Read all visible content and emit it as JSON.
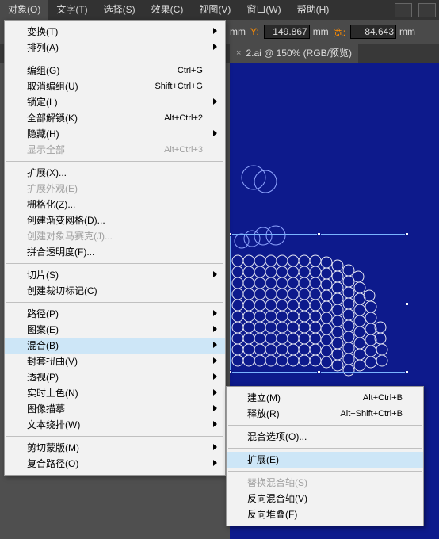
{
  "menubar": {
    "items": [
      "对象(O)",
      "文字(T)",
      "选择(S)",
      "效果(C)",
      "视图(V)",
      "窗口(W)",
      "帮助(H)"
    ]
  },
  "ctrlbar": {
    "unit": "mm",
    "y_label": "Y:",
    "y_value": "149.867",
    "w_label": "宽:",
    "w_value": "84.643"
  },
  "tab": {
    "title": "2.ai @ 150% (RGB/预览)",
    "close": "×"
  },
  "dropdown": {
    "groups": [
      [
        {
          "label": "变换(T)",
          "sc": "",
          "sub": true
        },
        {
          "label": "排列(A)",
          "sc": "",
          "sub": true
        }
      ],
      [
        {
          "label": "编组(G)",
          "sc": "Ctrl+G"
        },
        {
          "label": "取消编组(U)",
          "sc": "Shift+Ctrl+G"
        },
        {
          "label": "锁定(L)",
          "sc": "",
          "sub": true
        },
        {
          "label": "全部解锁(K)",
          "sc": "Alt+Ctrl+2"
        },
        {
          "label": "隐藏(H)",
          "sc": "",
          "sub": true
        },
        {
          "label": "显示全部",
          "sc": "Alt+Ctrl+3",
          "dis": true
        }
      ],
      [
        {
          "label": "扩展(X)..."
        },
        {
          "label": "扩展外观(E)",
          "dis": true
        },
        {
          "label": "栅格化(Z)..."
        },
        {
          "label": "创建渐变网格(D)..."
        },
        {
          "label": "创建对象马赛克(J)...",
          "dis": true
        },
        {
          "label": "拼合透明度(F)..."
        }
      ],
      [
        {
          "label": "切片(S)",
          "sub": true
        },
        {
          "label": "创建裁切标记(C)"
        }
      ],
      [
        {
          "label": "路径(P)",
          "sub": true
        },
        {
          "label": "图案(E)",
          "sub": true
        },
        {
          "label": "混合(B)",
          "sub": true,
          "hl": true
        },
        {
          "label": "封套扭曲(V)",
          "sub": true
        },
        {
          "label": "透视(P)",
          "sub": true
        },
        {
          "label": "实时上色(N)",
          "sub": true
        },
        {
          "label": "图像描摹",
          "sub": true
        },
        {
          "label": "文本绕排(W)",
          "sub": true
        }
      ],
      [
        {
          "label": "剪切蒙版(M)",
          "sub": true
        },
        {
          "label": "复合路径(O)",
          "sub": true
        }
      ]
    ]
  },
  "submenu": {
    "groups": [
      [
        {
          "label": "建立(M)",
          "sc": "Alt+Ctrl+B"
        },
        {
          "label": "释放(R)",
          "sc": "Alt+Shift+Ctrl+B"
        }
      ],
      [
        {
          "label": "混合选项(O)..."
        }
      ],
      [
        {
          "label": "扩展(E)",
          "hl": true
        }
      ],
      [
        {
          "label": "替换混合轴(S)",
          "dis": true
        },
        {
          "label": "反向混合轴(V)"
        },
        {
          "label": "反向堆叠(F)"
        }
      ]
    ]
  }
}
